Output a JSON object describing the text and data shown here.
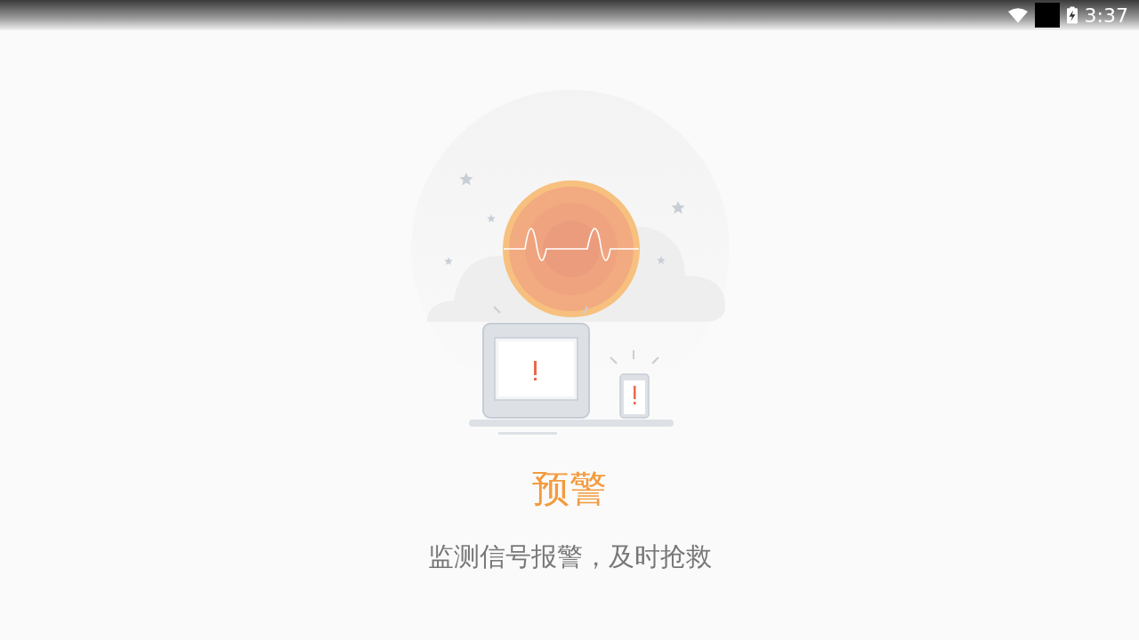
{
  "status_bar": {
    "time": "3:37"
  },
  "title": "预警",
  "subtitle": "监测信号报警，及时抢救"
}
